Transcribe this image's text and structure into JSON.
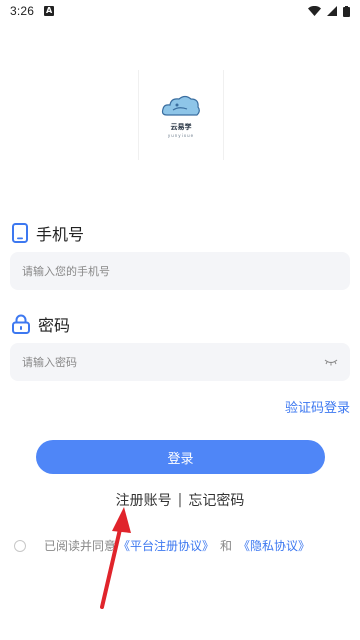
{
  "status_bar": {
    "time": "3:26",
    "notification_letter": "A",
    "icons": [
      "wifi-icon",
      "signal-icon",
      "battery-icon"
    ]
  },
  "logo": {
    "name": "云易学",
    "subtitle": "yunyixue"
  },
  "phone": {
    "label": "手机号",
    "placeholder": "请输入您的手机号",
    "icon": "phone-icon"
  },
  "password": {
    "label": "密码",
    "placeholder": "请输入密码",
    "icon": "lock-icon",
    "toggle_icon": "eye-closed-icon"
  },
  "links": {
    "sms_login": "验证码登录",
    "register": "注册账号",
    "separator": "|",
    "forgot": "忘记密码"
  },
  "login_button": "登录",
  "agreement": {
    "prefix": "已阅读并同意",
    "platform": "《平台注册协议》",
    "and": "和",
    "privacy": "《隐私协议》"
  },
  "colors": {
    "primary": "#4f86f7",
    "link": "#3d78f0",
    "annotation_arrow": "#e0242b"
  }
}
